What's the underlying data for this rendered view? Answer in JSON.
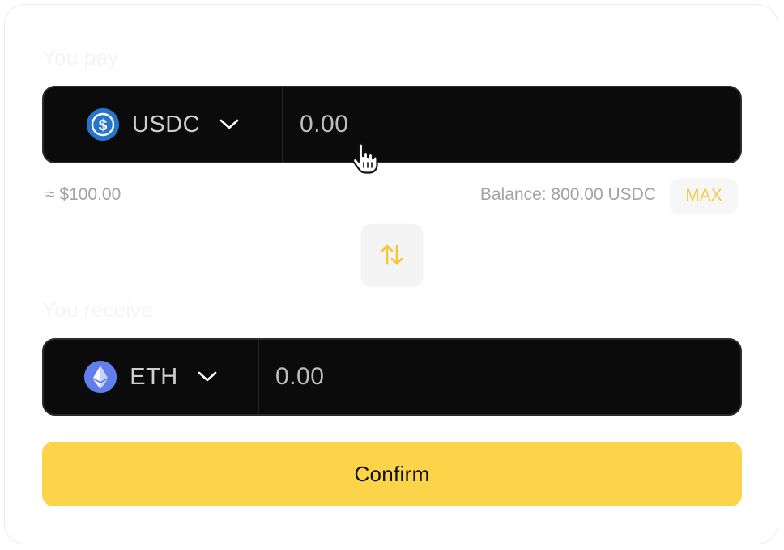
{
  "pay": {
    "label": "You pay",
    "token": {
      "symbol": "USDC",
      "icon": "usdc-icon",
      "color": "#2775CA"
    },
    "amount_placeholder": "0.00",
    "usd_value": "≈ $100.00",
    "balance": "Balance: 800.00 USDC",
    "max_label": "MAX"
  },
  "swap": {
    "icon": "swap-arrows-icon"
  },
  "receive": {
    "label": "You receive",
    "token": {
      "symbol": "ETH",
      "icon": "eth-icon",
      "color": "#627EEA"
    },
    "amount_placeholder": "0.00"
  },
  "confirm_label": "Confirm",
  "colors": {
    "accent": "#FBD44A",
    "input_background": "#0B0B0B",
    "max_text": "#F5CD48"
  }
}
